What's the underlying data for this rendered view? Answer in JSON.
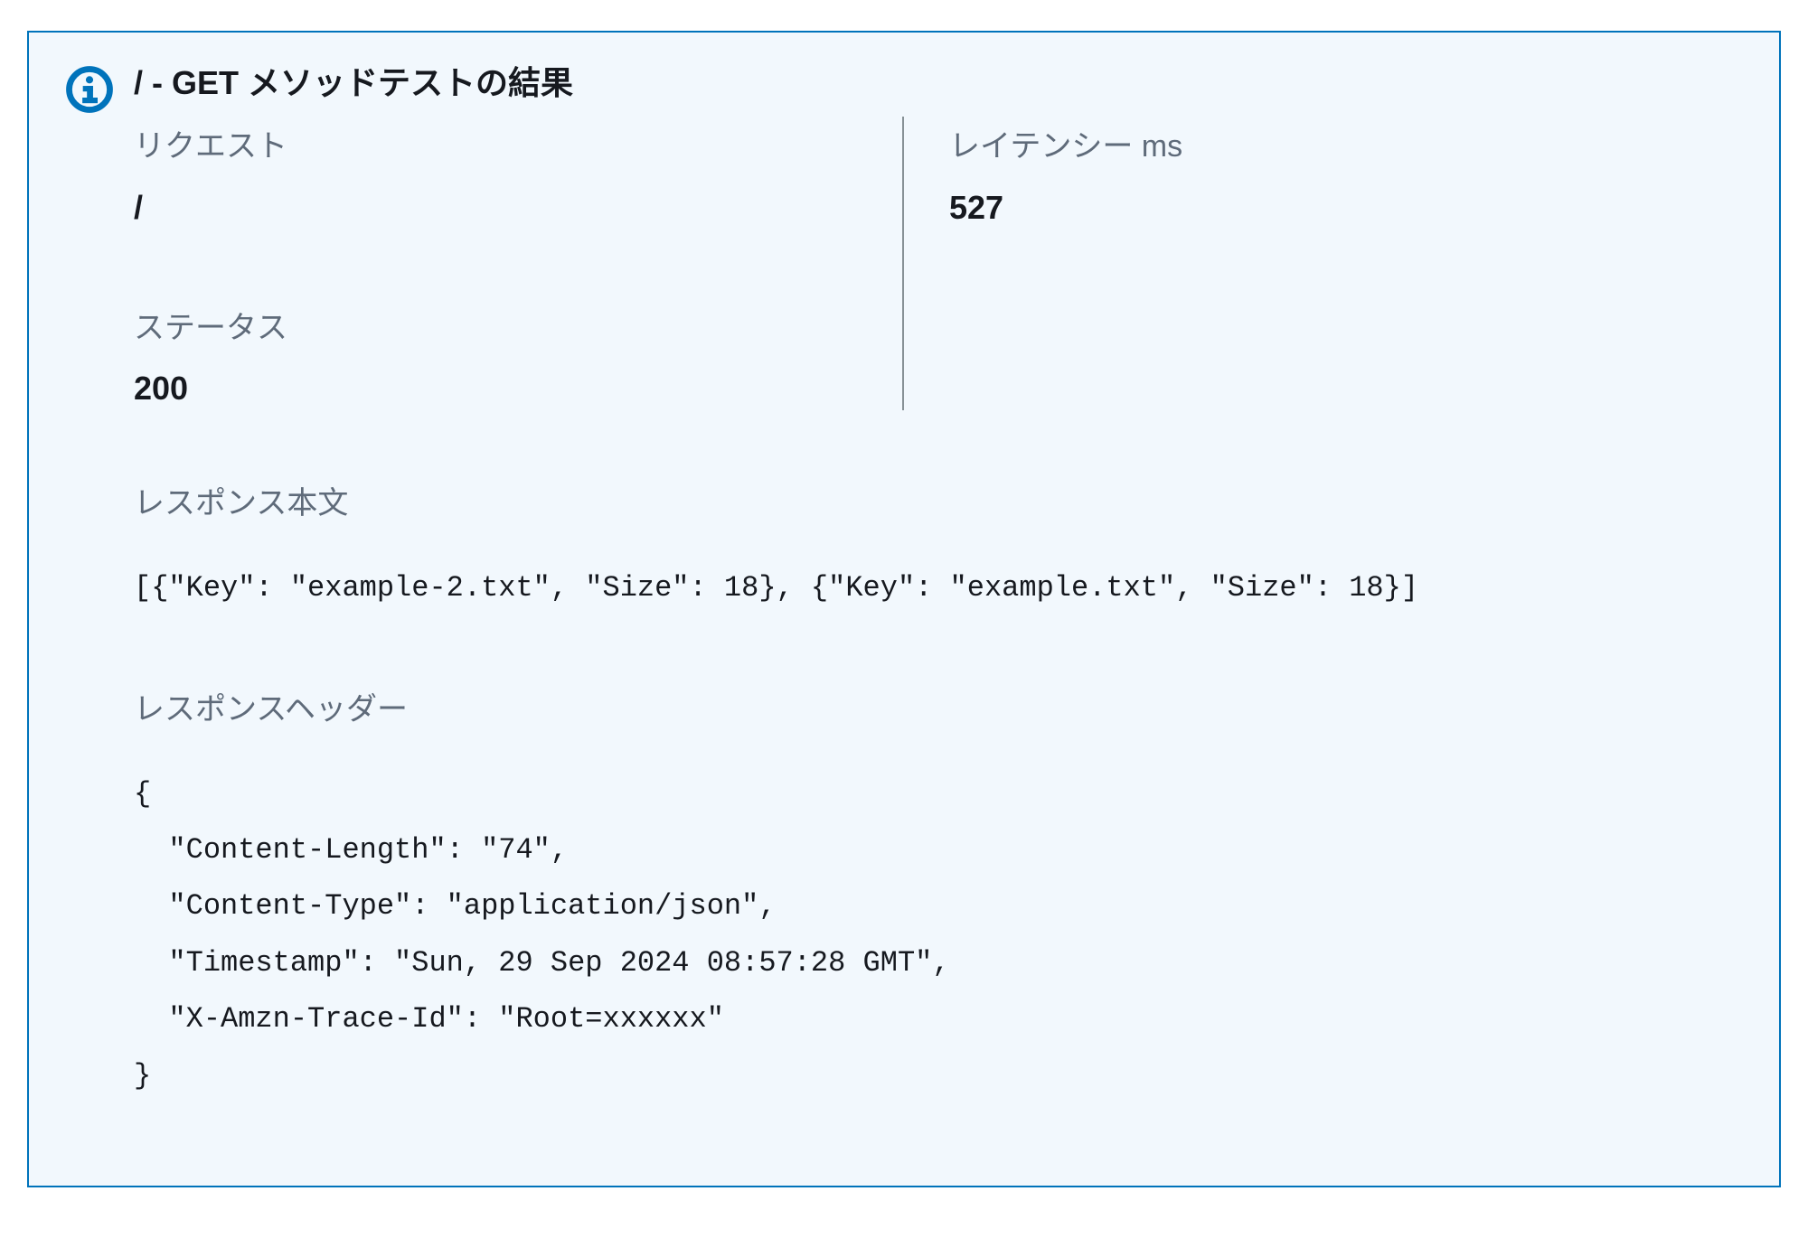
{
  "panel": {
    "title": "/ - GET メソッドテストの結果",
    "request": {
      "label": "リクエスト",
      "value": "/"
    },
    "latency": {
      "label": "レイテンシー ms",
      "value": "527"
    },
    "status": {
      "label": "ステータス",
      "value": "200"
    },
    "response_body": {
      "label": "レスポンス本文",
      "value": "[{\"Key\": \"example-2.txt\", \"Size\": 18}, {\"Key\": \"example.txt\", \"Size\": 18}]"
    },
    "response_headers": {
      "label": "レスポンスヘッダー",
      "value": "{\n  \"Content-Length\": \"74\",\n  \"Content-Type\": \"application/json\",\n  \"Timestamp\": \"Sun, 29 Sep 2024 08:57:28 GMT\",\n  \"X-Amzn-Trace-Id\": \"Root=xxxxxx\"\n}"
    }
  }
}
